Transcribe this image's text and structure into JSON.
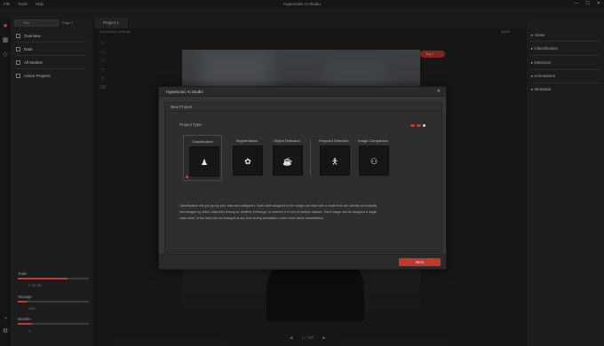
{
  "app": {
    "title": "Hypersonic AI Studio",
    "menu": [
      "File",
      "Tools",
      "Help"
    ],
    "window_buttons": [
      "—",
      "☐",
      "✕"
    ]
  },
  "left_panel": {
    "search_placeholder": "Text",
    "page_selector": "Page 1",
    "nav": [
      {
        "label": "Overview",
        "icon": "document-icon"
      },
      {
        "label": "Data",
        "icon": "database-icon"
      },
      {
        "label": "All Models",
        "icon": "layers-icon"
      },
      {
        "label": "Active Projects",
        "icon": "folder-icon"
      }
    ],
    "metrics": [
      {
        "label": "Total",
        "value": "2.18 GB",
        "fill": 0.7
      },
      {
        "label": "Storage",
        "value": "14%",
        "fill": 0.14
      },
      {
        "label": "Models",
        "value": "4",
        "fill": 0.2
      }
    ]
  },
  "canvas": {
    "tab": "Project 1",
    "subtool_label": "Annotation Settings",
    "zoom": "100%",
    "tag_label": "Tag 1",
    "pager": {
      "prev": "◀",
      "page": "1 / 100",
      "next": "▶"
    }
  },
  "right_panel": {
    "sections": [
      "▸ Views",
      "▸ Classification",
      "▸ Detection",
      "▸ Annotations",
      "▸ Metadata"
    ]
  },
  "modal": {
    "title": "Hypersonic AI Studio",
    "close": "✕",
    "inner_title": "New Project",
    "project_type_label": "Project Type",
    "cards": [
      {
        "label": "Classification",
        "icon": "classification-icon",
        "glyph": "♟",
        "selected": true
      },
      {
        "label": "Segmentation",
        "icon": "segmentation-icon",
        "glyph": "✿",
        "selected": false
      },
      {
        "label": "Object Detection",
        "icon": "object-detection-icon",
        "glyph": "☕",
        "selected": false
      },
      {
        "label": "Keypoint Detection",
        "icon": "keypoint-icon",
        "glyph": "🯅",
        "selected": false
      },
      {
        "label": "Image Comparison",
        "icon": "image-comparison-icon",
        "glyph": "⚇",
        "selected": false
      }
    ],
    "description_lines": [
      "Classification lets you group your data into categories. Each label assigned to the image can help train a model that can identify and classify",
      "new images by which class they belong to, whether it belongs, or whether it is one of multiple classes. Each image can be assigned a single",
      "class label, or the label can be changed at any time during annotation. Learn more about classification"
    ],
    "next_button": "Next"
  },
  "colors": {
    "accent": "#c0392b",
    "link": "#6aa6c8",
    "panel": "#1c1c1c",
    "modal": "#353535"
  }
}
